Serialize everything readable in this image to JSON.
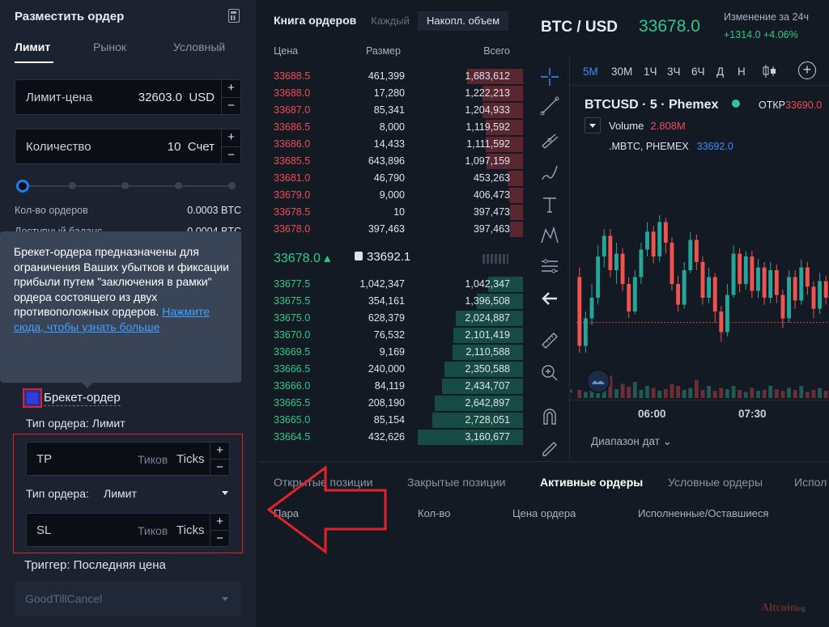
{
  "order_panel": {
    "title": "Разместить ордер",
    "calculator_icon": "calculator-icon",
    "tabs": [
      {
        "label": "Лимит",
        "active": true
      },
      {
        "label": "Рынок",
        "active": false
      },
      {
        "label": "Условный",
        "active": false
      }
    ],
    "limit_price": {
      "label": "Лимит-цена",
      "value": "32603.0",
      "unit": "USD"
    },
    "quantity": {
      "label": "Количество",
      "value": "10",
      "unit": "Счет"
    },
    "slider_percent": 0,
    "order_qty_label": "Кол-во ордеров",
    "order_qty_value": "0.0003 BTC",
    "available_label": "Доступный баланс",
    "available_value": "0.0004 BTC",
    "tooltip": {
      "text": "Брекет-ордера предназначены для ограничения Ваших убытков и фиксации прибыли путем \"заключения в рамки\" ордера состоящего из двух противоположных ордеров.",
      "link": "Нажмите сюда, чтобы узнать больше"
    },
    "bracket_label": "Брекет-ордер",
    "bracket_checked": true,
    "order_type_label_1": "Тип ордера: Лимит",
    "tp": {
      "label": "TP",
      "placeholder": "Тиков",
      "unit": "Ticks"
    },
    "order_type_label_2": "Тип ордера:",
    "order_type_value_2": "Лимит",
    "sl": {
      "label": "SL",
      "placeholder": "Тиков",
      "unit": "Ticks"
    },
    "trigger_label": "Триггер: Последняя цена",
    "time_in_force": "GoodTillCancel"
  },
  "order_book": {
    "title": "Книга ордеров",
    "mode_each": "Каждый",
    "mode_cumulative": "Накопл. объем",
    "headers": {
      "price": "Цена",
      "size": "Размер",
      "total": "Всего"
    },
    "max_total": 3160677,
    "asks": [
      {
        "price": "33688.5",
        "size": "461,399",
        "total": "1,683,612",
        "total_n": 1683612
      },
      {
        "price": "33688.0",
        "size": "17,280",
        "total": "1,222,213",
        "total_n": 1222213
      },
      {
        "price": "33687.0",
        "size": "85,341",
        "total": "1,204,933",
        "total_n": 1204933
      },
      {
        "price": "33686.5",
        "size": "8,000",
        "total": "1,119,592",
        "total_n": 1119592
      },
      {
        "price": "33686.0",
        "size": "14,433",
        "total": "1,111,592",
        "total_n": 1111592
      },
      {
        "price": "33685.5",
        "size": "643,896",
        "total": "1,097,159",
        "total_n": 1097159
      },
      {
        "price": "33681.0",
        "size": "46,790",
        "total": "453,263",
        "total_n": 453263
      },
      {
        "price": "33679.0",
        "size": "9,000",
        "total": "406,473",
        "total_n": 406473
      },
      {
        "price": "33678.5",
        "size": "10",
        "total": "397,473",
        "total_n": 397473
      },
      {
        "price": "33678.0",
        "size": "397,463",
        "total": "397,463",
        "total_n": 397463
      }
    ],
    "last_price": "33678.0",
    "index_price": "33692.1",
    "bids": [
      {
        "price": "33677.5",
        "size": "1,042,347",
        "total": "1,042,347",
        "total_n": 1042347
      },
      {
        "price": "33675.5",
        "size": "354,161",
        "total": "1,396,508",
        "total_n": 1396508
      },
      {
        "price": "33675.0",
        "size": "628,379",
        "total": "2,024,887",
        "total_n": 2024887
      },
      {
        "price": "33670.0",
        "size": "76,532",
        "total": "2,101,419",
        "total_n": 2101419
      },
      {
        "price": "33669.5",
        "size": "9,169",
        "total": "2,110,588",
        "total_n": 2110588
      },
      {
        "price": "33666.5",
        "size": "240,000",
        "total": "2,350,588",
        "total_n": 2350588
      },
      {
        "price": "33666.0",
        "size": "84,119",
        "total": "2,434,707",
        "total_n": 2434707
      },
      {
        "price": "33665.5",
        "size": "208,190",
        "total": "2,642,897",
        "total_n": 2642897
      },
      {
        "price": "33665.0",
        "size": "85,154",
        "total": "2,728,051",
        "total_n": 2728051
      },
      {
        "price": "33664.5",
        "size": "432,626",
        "total": "3,160,677",
        "total_n": 3160677
      }
    ]
  },
  "ticker": {
    "pair": "BTC / USD",
    "last_price": "33678.0",
    "change_label": "Изменение за 24ч",
    "change_value": "+1314.0 +4.06%"
  },
  "chart": {
    "timeframes": [
      {
        "label": "5M",
        "active": true
      },
      {
        "label": "30M",
        "active": false
      },
      {
        "label": "1Ч",
        "active": false
      },
      {
        "label": "3Ч",
        "active": false
      },
      {
        "label": "6Ч",
        "active": false
      },
      {
        "label": "Д",
        "active": false
      },
      {
        "label": "Н",
        "active": false
      }
    ],
    "symbol_line": "BTCUSD · 5 · Phemex",
    "open_label": "ОТКР",
    "open_value": "33690.0",
    "volume_label": "Volume",
    "volume_value": "2.808M",
    "index_label": ".MBTC, PHEMEX",
    "index_value": "33692.0",
    "time_labels": [
      "06:00",
      "07:30"
    ],
    "range_label": "Диапазон дат",
    "colors": {
      "up": "#26a69a",
      "down": "#ef5350"
    },
    "candles": [
      [
        0.55,
        0.05,
        0.62,
        0.0
      ],
      [
        0.05,
        0.25,
        0.3,
        0.0
      ],
      [
        0.25,
        0.4,
        0.5,
        0.2
      ],
      [
        0.4,
        0.7,
        0.78,
        0.35
      ],
      [
        0.7,
        0.85,
        0.9,
        0.62
      ],
      [
        0.85,
        0.6,
        0.9,
        0.55
      ],
      [
        0.6,
        0.72,
        0.8,
        0.5
      ],
      [
        0.72,
        0.5,
        0.76,
        0.45
      ],
      [
        0.5,
        0.3,
        0.55,
        0.25
      ],
      [
        0.3,
        0.55,
        0.6,
        0.28
      ],
      [
        0.55,
        0.75,
        0.8,
        0.5
      ],
      [
        0.75,
        0.88,
        0.95,
        0.7
      ],
      [
        0.88,
        0.7,
        0.92,
        0.65
      ],
      [
        0.7,
        0.95,
        1.0,
        0.66
      ],
      [
        0.95,
        0.8,
        0.98,
        0.72
      ],
      [
        0.8,
        0.5,
        0.84,
        0.45
      ],
      [
        0.5,
        0.35,
        0.56,
        0.3
      ],
      [
        0.35,
        0.6,
        0.66,
        0.32
      ],
      [
        0.6,
        0.82,
        0.88,
        0.58
      ],
      [
        0.82,
        0.66,
        0.86,
        0.6
      ],
      [
        0.66,
        0.4,
        0.7,
        0.35
      ],
      [
        0.4,
        0.55,
        0.62,
        0.36
      ],
      [
        0.55,
        0.3,
        0.58,
        0.22
      ],
      [
        0.3,
        0.15,
        0.34,
        0.08
      ],
      [
        0.15,
        0.42,
        0.5,
        0.12
      ],
      [
        0.42,
        0.72,
        0.78,
        0.4
      ],
      [
        0.72,
        0.5,
        0.76,
        0.44
      ],
      [
        0.5,
        0.7,
        0.74,
        0.46
      ],
      [
        0.7,
        0.45,
        0.74,
        0.4
      ],
      [
        0.45,
        0.62,
        0.68,
        0.4
      ],
      [
        0.62,
        0.4,
        0.66,
        0.35
      ],
      [
        0.4,
        0.6,
        0.66,
        0.36
      ],
      [
        0.6,
        0.42,
        0.64,
        0.36
      ],
      [
        0.42,
        0.25,
        0.46,
        0.18
      ],
      [
        0.25,
        0.55,
        0.6,
        0.22
      ],
      [
        0.55,
        0.38,
        0.6,
        0.32
      ],
      [
        0.38,
        0.62,
        0.68,
        0.35
      ],
      [
        0.62,
        0.48,
        0.66,
        0.42
      ],
      [
        0.48,
        0.32,
        0.52,
        0.25
      ],
      [
        0.32,
        0.52,
        0.58,
        0.28
      ],
      [
        0.52,
        0.4,
        0.56,
        0.35
      ]
    ],
    "price_line_level": 0.22,
    "volume_heights": [
      0.2,
      0.15,
      0.25,
      0.18,
      0.3,
      0.55,
      0.22,
      0.35,
      0.28,
      0.4,
      0.2,
      0.3,
      0.25,
      0.18,
      0.22,
      0.35,
      0.3,
      0.2,
      0.25,
      0.45,
      0.2,
      0.3,
      0.18,
      0.25,
      0.22,
      0.3,
      0.2,
      0.15,
      0.25,
      0.18,
      0.2,
      0.3,
      0.22,
      0.18,
      0.25,
      0.2,
      0.3,
      0.15,
      0.2,
      0.25,
      0.18
    ]
  },
  "bottom_panel": {
    "tabs": [
      {
        "label": "Открытые позиции",
        "active": false
      },
      {
        "label": "Закрытые позиции",
        "active": false
      },
      {
        "label": "Активные ордеры",
        "active": true
      },
      {
        "label": "Условные ордеры",
        "active": false
      },
      {
        "label": "Испол",
        "active": false
      }
    ],
    "columns": [
      "Пара",
      "Кол-во",
      "Цена ордера",
      "Исполненные/Оставшиеся"
    ]
  },
  "watermark": {
    "brand": "Altcoin",
    "suffix": "log"
  }
}
